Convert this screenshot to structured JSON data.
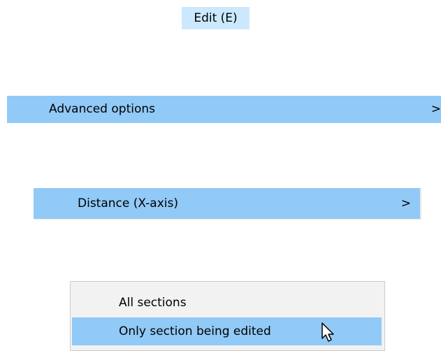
{
  "menu_title": "Edit (E)",
  "advanced_row": {
    "label": "Advanced options",
    "chevron": ">"
  },
  "distance_row": {
    "label": "Distance (X-axis)",
    "chevron": ">"
  },
  "submenu": {
    "items": [
      {
        "label": "All sections"
      },
      {
        "label": "Only section being edited"
      }
    ]
  },
  "icons": {
    "cursor": "mouse-pointer-icon"
  },
  "colors": {
    "title_bg": "#cce8ff",
    "highlight": "#91c9f7",
    "submenu_bg": "#f2f2f2"
  }
}
